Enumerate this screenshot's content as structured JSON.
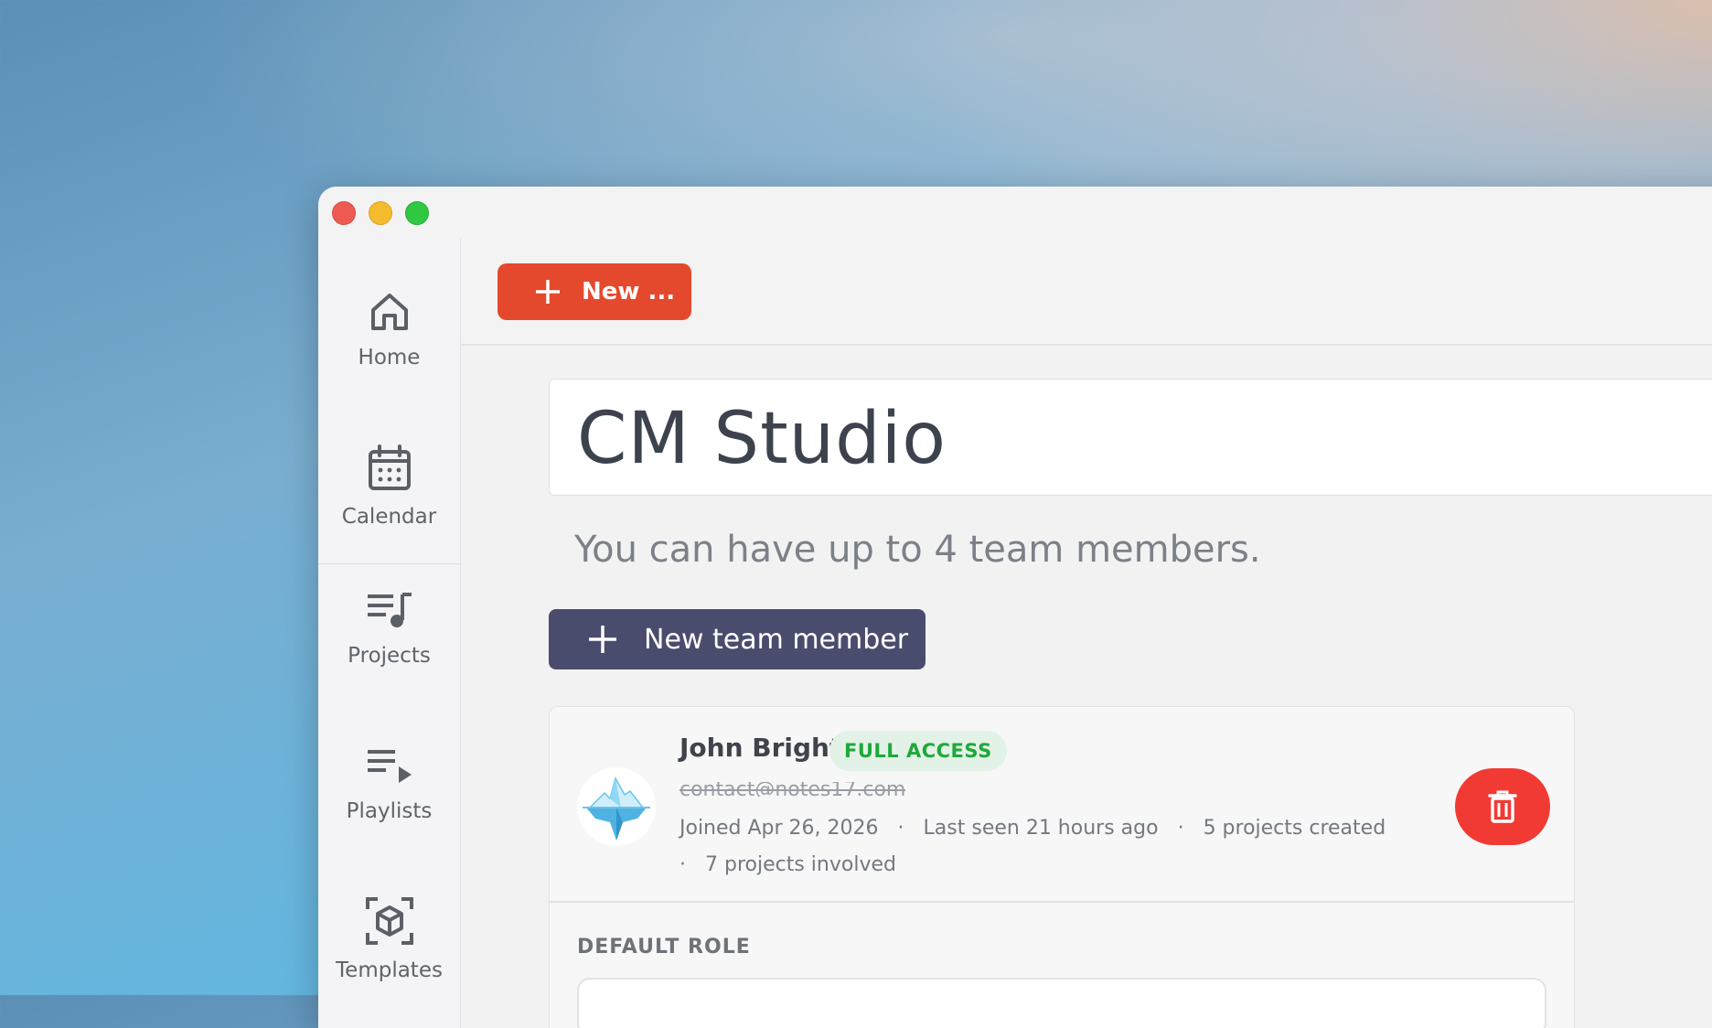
{
  "window": {
    "traffic_lights": [
      "close",
      "minimize",
      "zoom"
    ]
  },
  "sidebar": {
    "items": [
      {
        "label": "Home",
        "icon": "home-icon"
      },
      {
        "label": "Calendar",
        "icon": "calendar-icon"
      },
      {
        "label": "Projects",
        "icon": "music-list-icon"
      },
      {
        "label": "Playlists",
        "icon": "playlist-play-icon"
      },
      {
        "label": "Templates",
        "icon": "cube-scan-icon"
      }
    ]
  },
  "toolbar": {
    "new_label": "New ...",
    "new_color": "#e5492d"
  },
  "studio": {
    "name": "CM Studio",
    "limit_text": "You can have up to 4 team members.",
    "new_member_label": "New team member"
  },
  "member": {
    "name": "John Bright",
    "access_badge": "FULL ACCESS",
    "email": "contact@notes17.com",
    "joined": "Joined Apr 26, 2026",
    "last_seen": "Last seen 21 hours ago",
    "projects_created": "5 projects created",
    "projects_involved": "7 projects involved",
    "separator": "·",
    "delete_color": "#f23a34"
  },
  "role_section": {
    "label": "DEFAULT ROLE"
  }
}
